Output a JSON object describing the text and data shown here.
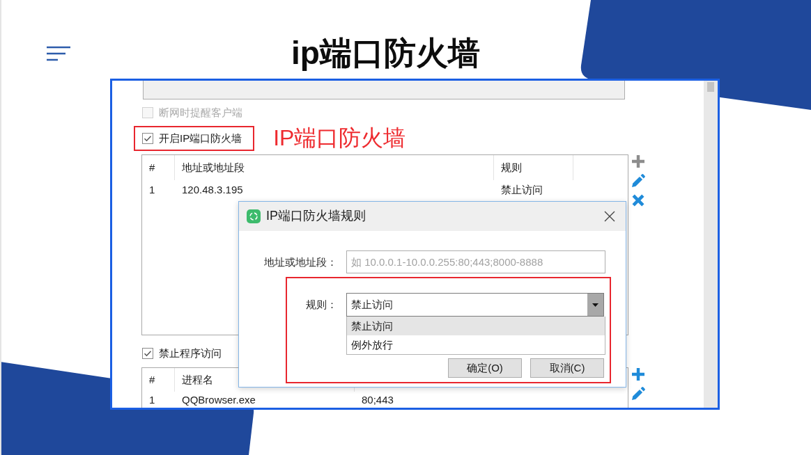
{
  "slide": {
    "title": "ip端口防火墙"
  },
  "settings": {
    "top_field": {
      "disabled": true
    },
    "options": [
      {
        "label": "断网时提醒客户端",
        "checked": false,
        "disabled": true,
        "annotated": false
      },
      {
        "label": "开启IP端口防火墙",
        "checked": true,
        "disabled": false,
        "annotated": true,
        "note": "IP端口防火墙"
      }
    ],
    "address_table": {
      "columns": [
        "#",
        "地址或地址段",
        "规则"
      ],
      "rows": [
        [
          "1",
          "120.48.3.195",
          "禁止访问"
        ]
      ],
      "tools": [
        {
          "kind": "add",
          "disabled": true
        },
        {
          "kind": "edit",
          "disabled": false
        },
        {
          "kind": "delete",
          "disabled": false
        }
      ]
    },
    "program_option": {
      "label": "禁止程序访问",
      "checked": true,
      "disabled": false
    },
    "program_table": {
      "columns": [
        "#",
        "进程名"
      ],
      "rows": [
        [
          "1",
          "QQBrowser.exe",
          "80;443"
        ]
      ],
      "tools": [
        {
          "kind": "add",
          "disabled": false
        },
        {
          "kind": "edit",
          "disabled": false
        }
      ]
    }
  },
  "dialog": {
    "title": "IP端口防火墙规则",
    "address_field": {
      "label": "地址或地址段：",
      "placeholder": "如 10.0.0.1-10.0.0.255:80;443;8000-8888"
    },
    "rule_field": {
      "label": "规则：",
      "value": "禁止访问",
      "expanded": true,
      "annotated": true,
      "options": [
        {
          "label": "禁止访问",
          "selected": true
        },
        {
          "label": "例外放行",
          "selected": false
        }
      ]
    },
    "buttons": [
      {
        "label": "确定(O)"
      },
      {
        "label": "取消(C)"
      }
    ]
  }
}
